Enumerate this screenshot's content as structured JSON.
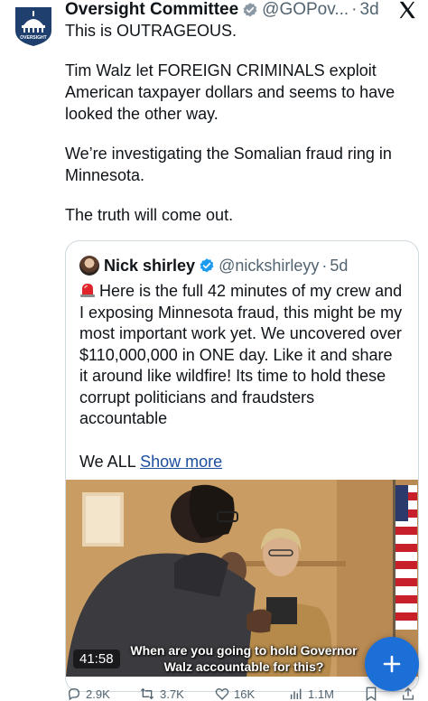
{
  "tweet": {
    "author_name": "Oversight Committee",
    "handle": "@GOPov...",
    "separator": "·",
    "time": "3d",
    "paragraphs": [
      "This is OUTRAGEOUS.",
      "Tim Walz let FOREIGN CRIMINALS exploit American taxpayer dollars and seems to have looked the other way.",
      "We’re investigating the Somalian fraud ring in Minnesota.",
      "The truth will come out."
    ],
    "avatar_text": "OVERSIGHT"
  },
  "quote": {
    "author_name": "Nick shirley",
    "handle": "@nickshirleyy",
    "separator": "·",
    "time": "5d",
    "text": "Here is the full 42 minutes of my crew and I exposing Minnesota fraud, this might be my most important work yet. We uncovered over $110,000,000 in ONE day. Like it and share it around like wildfire! Its time to hold these corrupt politicians and fraudsters accountable",
    "more_prefix": "We ALL",
    "show_more": "Show more",
    "video": {
      "duration": "41:58",
      "caption_line1": "When are you going to hold Governor",
      "caption_line2": "Walz accountable for this?"
    }
  },
  "actions": {
    "replies": "2.9K",
    "reposts": "3.7K",
    "likes": "16K",
    "views": "1.1M"
  },
  "colors": {
    "text": "#0f1419",
    "muted": "#536471",
    "verified": "#8b98a5",
    "verified_blue": "#1d9bf0",
    "link": "#1d4ea0",
    "fab": "#1d6fd8",
    "border": "#cfd9de"
  },
  "icons": [
    "capitol-logo-icon",
    "verified-badge-icon",
    "x-logo-icon",
    "siren-icon",
    "reply-icon",
    "repost-icon",
    "like-icon",
    "views-icon",
    "bookmark-icon",
    "share-icon",
    "plus-icon"
  ]
}
